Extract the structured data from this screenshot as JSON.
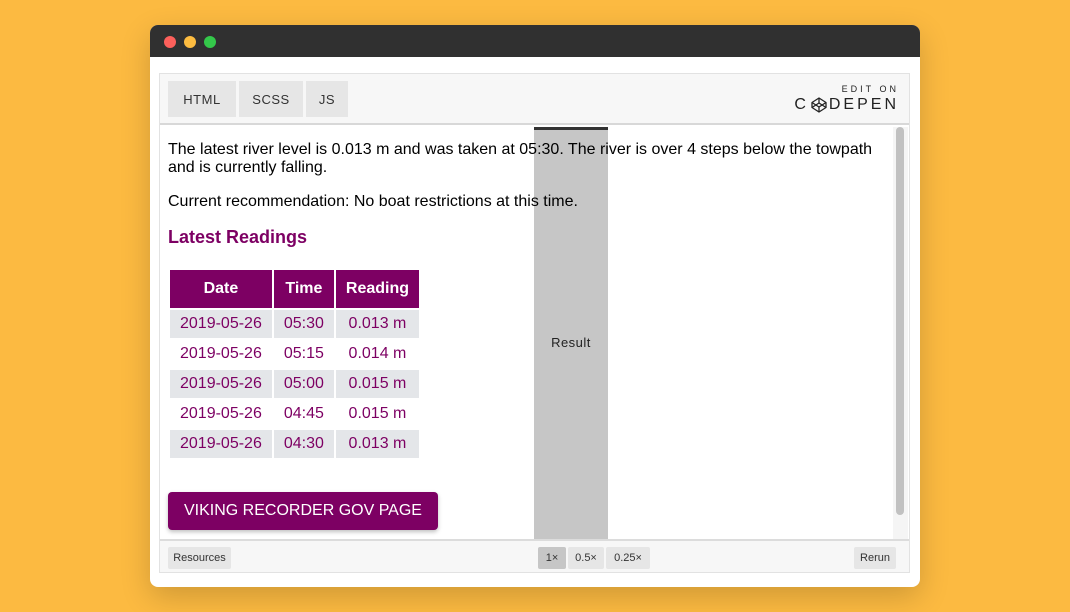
{
  "codepen": {
    "tabs": {
      "html": "HTML",
      "scss": "SCSS",
      "js": "JS",
      "result": "Result"
    },
    "brand": {
      "edit_on": "EDIT ON",
      "name_before": "C",
      "name_after": "DEPEN"
    }
  },
  "content": {
    "status_text": "The latest river level is 0.013 m and was taken at 05:30. The river is over 4 steps below the towpath and is currently falling.",
    "recommendation": "Current recommendation: No boat restrictions at this time.",
    "heading": "Latest Readings",
    "table": {
      "headers": [
        "Date",
        "Time",
        "Reading"
      ],
      "rows": [
        [
          "2019-05-26",
          "05:30",
          "0.013 m"
        ],
        [
          "2019-05-26",
          "05:15",
          "0.014 m"
        ],
        [
          "2019-05-26",
          "05:00",
          "0.015 m"
        ],
        [
          "2019-05-26",
          "04:45",
          "0.015 m"
        ],
        [
          "2019-05-26",
          "04:30",
          "0.013 m"
        ]
      ]
    },
    "button_label": "VIKING RECORDER GOV PAGE"
  },
  "footer": {
    "resources": "Resources",
    "zoom": [
      "1×",
      "0.5×",
      "0.25×"
    ],
    "rerun": "Rerun"
  },
  "colors": {
    "background": "#fcba41",
    "accent": "#7d0063",
    "titlebar": "#303030",
    "row_alt": "#e4e6e9"
  }
}
